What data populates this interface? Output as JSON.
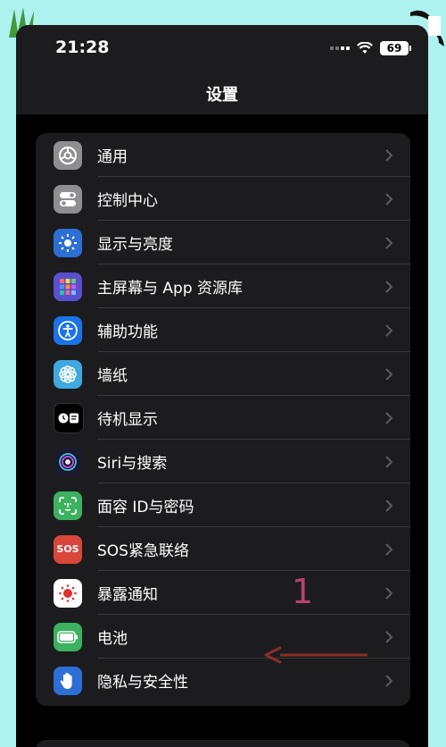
{
  "status_bar": {
    "time": "21:28",
    "battery": "69"
  },
  "nav": {
    "title": "设置"
  },
  "settings_items": [
    {
      "label": "通用",
      "icon": "gear-icon",
      "color": "#8e8e93"
    },
    {
      "label": "控制中心",
      "icon": "toggles-icon",
      "color": "#8e8e93"
    },
    {
      "label": "显示与亮度",
      "icon": "sun-icon",
      "color": "#2d6fd4"
    },
    {
      "label": "主屏幕与 App 资源库",
      "icon": "app-grid-icon",
      "color": "#5a4fcf"
    },
    {
      "label": "辅助功能",
      "icon": "accessibility-icon",
      "color": "#1a73e8"
    },
    {
      "label": "墙纸",
      "icon": "flower-icon",
      "color": "#3fa9e0"
    },
    {
      "label": "待机显示",
      "icon": "standby-icon",
      "color": "#000000"
    },
    {
      "label": "Siri与搜索",
      "icon": "siri-icon",
      "color": "#1a1a2e"
    },
    {
      "label": "面容 ID与密码",
      "icon": "face-id-icon",
      "color": "#3cb15f"
    },
    {
      "label": "SOS紧急联络",
      "icon": "sos-icon",
      "color": "#d9463b"
    },
    {
      "label": "暴露通知",
      "icon": "exposure-icon",
      "color": "#ffffff"
    },
    {
      "label": "电池",
      "icon": "battery-icon",
      "color": "#3cb15f"
    },
    {
      "label": "隐私与安全性",
      "icon": "hand-icon",
      "color": "#2d6fd4"
    }
  ],
  "sos_icon_text": "SOS",
  "annotation": {
    "number": "1",
    "color": "#b3456b"
  }
}
